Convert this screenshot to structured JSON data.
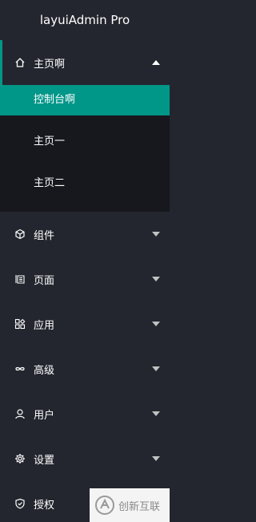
{
  "app": {
    "title": "layuiAdmin Pro"
  },
  "menu": {
    "home": {
      "label": "主页啊",
      "icon": "home-icon",
      "children": [
        "控制台啊",
        "主页一",
        "主页二"
      ]
    },
    "items": [
      {
        "label": "组件",
        "icon": "cube-icon"
      },
      {
        "label": "页面",
        "icon": "page-icon"
      },
      {
        "label": "应用",
        "icon": "apps-icon"
      },
      {
        "label": "高级",
        "icon": "infinity-icon"
      },
      {
        "label": "用户",
        "icon": "user-icon"
      },
      {
        "label": "设置",
        "icon": "gear-icon"
      },
      {
        "label": "授权",
        "icon": "shield-icon"
      }
    ]
  },
  "watermark": {
    "text": "创新互联"
  },
  "colors": {
    "sidebar_bg": "#24262f",
    "submenu_bg": "#17181d",
    "accent": "#009688"
  }
}
